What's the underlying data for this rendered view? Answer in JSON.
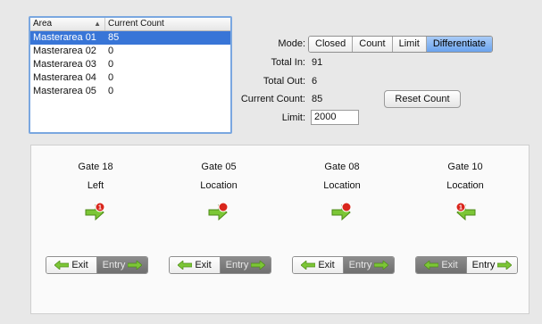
{
  "area_table": {
    "headers": [
      "Area",
      "Current Count"
    ],
    "rows": [
      {
        "area": "Masterarea 01",
        "count": "85"
      },
      {
        "area": "Masterarea 02",
        "count": "0"
      },
      {
        "area": "Masterarea 03",
        "count": "0"
      },
      {
        "area": "Masterarea 04",
        "count": "0"
      },
      {
        "area": "Masterarea 05",
        "count": "0"
      }
    ],
    "selected_index": 0
  },
  "mode": {
    "label": "Mode:",
    "options": [
      "Closed",
      "Count",
      "Limit",
      "Differentiate"
    ],
    "active": "Differentiate"
  },
  "stats": {
    "total_in_label": "Total In:",
    "total_in": "91",
    "total_out_label": "Total Out:",
    "total_out": "6",
    "current_count_label": "Current Count:",
    "current_count": "85",
    "reset_label": "Reset Count",
    "limit_label": "Limit:",
    "limit_value": "2000"
  },
  "gates": [
    {
      "name": "Gate 18",
      "sub": "Left",
      "icon": "exit-arrow-right-icon",
      "badge": "1",
      "exit_label": "Exit",
      "entry_label": "Entry",
      "active": "entry"
    },
    {
      "name": "Gate 05",
      "sub": "Location",
      "icon": "exit-arrow-right-icon",
      "badge": "",
      "exit_label": "Exit",
      "entry_label": "Entry",
      "active": "entry"
    },
    {
      "name": "Gate 08",
      "sub": "Location",
      "icon": "exit-arrow-right-icon",
      "badge": "",
      "exit_label": "Exit",
      "entry_label": "Entry",
      "active": "entry"
    },
    {
      "name": "Gate 10",
      "sub": "Location",
      "icon": "entry-arrow-left-icon",
      "badge": "1",
      "exit_label": "Exit",
      "entry_label": "Entry",
      "active": "exit"
    }
  ],
  "colors": {
    "selection": "#3875d7",
    "active_segment": "#6aa3ee",
    "arrow_green": "#6cbf2a",
    "badge_red": "#d9261c"
  }
}
